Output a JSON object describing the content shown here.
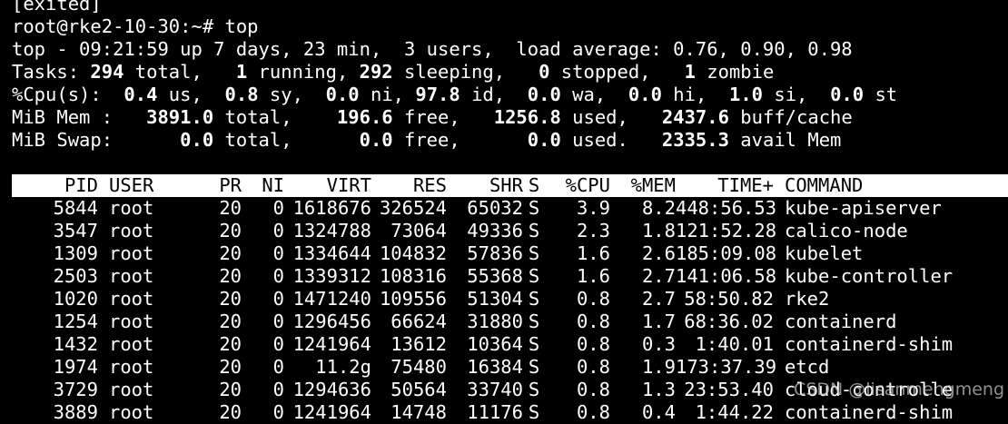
{
  "terminal": {
    "exited_line": "[exited]",
    "prompt": "root@rke2-10-30:~# top",
    "summary": {
      "uptime_line": "top - 09:21:59 up 7 days, 23 min,  3 users,  load average: 0.76, 0.90, 0.98",
      "tasks": {
        "label": "Tasks: ",
        "total": "294",
        "total_label": " total,   ",
        "running": "1",
        "running_label": " running, ",
        "sleeping": "292",
        "sleeping_label": " sleeping,   ",
        "stopped": "0",
        "stopped_label": " stopped,   ",
        "zombie": "1",
        "zombie_label": " zombie"
      },
      "cpu": {
        "label": "%Cpu(s):  ",
        "us": "0.4",
        "us_label": " us,  ",
        "sy": "0.8",
        "sy_label": " sy,  ",
        "ni": "0.0",
        "ni_label": " ni, ",
        "id": "97.8",
        "id_label": " id,  ",
        "wa": "0.0",
        "wa_label": " wa,  ",
        "hi": "0.0",
        "hi_label": " hi,  ",
        "si": "1.0",
        "si_label": " si,  ",
        "st": "0.0",
        "st_label": " st"
      },
      "mem": {
        "label": "MiB Mem :   ",
        "total": "3891.0",
        "total_label": " total,    ",
        "free": "196.6",
        "free_label": " free,   ",
        "used": "1256.8",
        "used_label": " used,   ",
        "buff": "2437.6",
        "buff_label": " buff/cache"
      },
      "swap": {
        "label": "MiB Swap:      ",
        "total": "0.0",
        "total_label": " total,      ",
        "free": "0.0",
        "free_label": " free,      ",
        "used": "0.0",
        "used_label": " used.   ",
        "avail": "2335.3",
        "avail_label": " avail Mem"
      }
    },
    "columns": {
      "pid": "PID",
      "user": "USER",
      "pr": "PR",
      "ni": "NI",
      "virt": "VIRT",
      "res": "RES",
      "shr": "SHR",
      "s": "S",
      "cpu": "%CPU",
      "mem": "%MEM",
      "time": "TIME+",
      "command": "COMMAND"
    },
    "processes": [
      {
        "pid": "5844",
        "user": "root",
        "pr": "20",
        "ni": "0",
        "virt": "1618676",
        "res": "326524",
        "shr": "65032",
        "s": "S",
        "cpu": "3.9",
        "mem": "8.2",
        "time": "448:56.53",
        "command": "kube-apiserver"
      },
      {
        "pid": "3547",
        "user": "root",
        "pr": "20",
        "ni": "0",
        "virt": "1324788",
        "res": "73064",
        "shr": "49336",
        "s": "S",
        "cpu": "2.3",
        "mem": "1.8",
        "time": "121:52.28",
        "command": "calico-node"
      },
      {
        "pid": "1309",
        "user": "root",
        "pr": "20",
        "ni": "0",
        "virt": "1334644",
        "res": "104832",
        "shr": "57836",
        "s": "S",
        "cpu": "1.6",
        "mem": "2.6",
        "time": "185:09.08",
        "command": "kubelet"
      },
      {
        "pid": "2503",
        "user": "root",
        "pr": "20",
        "ni": "0",
        "virt": "1339312",
        "res": "108316",
        "shr": "55368",
        "s": "S",
        "cpu": "1.6",
        "mem": "2.7",
        "time": "141:06.58",
        "command": "kube-controller"
      },
      {
        "pid": "1020",
        "user": "root",
        "pr": "20",
        "ni": "0",
        "virt": "1471240",
        "res": "109556",
        "shr": "51304",
        "s": "S",
        "cpu": "0.8",
        "mem": "2.7",
        "time": "58:50.82",
        "command": "rke2"
      },
      {
        "pid": "1254",
        "user": "root",
        "pr": "20",
        "ni": "0",
        "virt": "1296456",
        "res": "66624",
        "shr": "31880",
        "s": "S",
        "cpu": "0.8",
        "mem": "1.7",
        "time": "68:36.02",
        "command": "containerd"
      },
      {
        "pid": "1432",
        "user": "root",
        "pr": "20",
        "ni": "0",
        "virt": "1241964",
        "res": "13612",
        "shr": "10364",
        "s": "S",
        "cpu": "0.8",
        "mem": "0.3",
        "time": "1:40.01",
        "command": "containerd-shim"
      },
      {
        "pid": "1974",
        "user": "root",
        "pr": "20",
        "ni": "0",
        "virt": "11.2g",
        "res": "75480",
        "shr": "16384",
        "s": "S",
        "cpu": "0.8",
        "mem": "1.9",
        "time": "173:37.39",
        "command": "etcd"
      },
      {
        "pid": "3729",
        "user": "root",
        "pr": "20",
        "ni": "0",
        "virt": "1294636",
        "res": "50564",
        "shr": "33740",
        "s": "S",
        "cpu": "0.8",
        "mem": "1.3",
        "time": "23:53.40",
        "command": "cloud-controlle"
      },
      {
        "pid": "3889",
        "user": "root",
        "pr": "20",
        "ni": "0",
        "virt": "1241964",
        "res": "14748",
        "shr": "11176",
        "s": "S",
        "cpu": "0.8",
        "mem": "0.4",
        "time": "1:44.22",
        "command": "containerd-shim"
      }
    ]
  },
  "watermark": "CSDN @lisanmengmeng",
  "colors": {
    "background": "#000000",
    "foreground": "#ffffff",
    "header_background": "#ffffff",
    "header_foreground": "#000000"
  }
}
